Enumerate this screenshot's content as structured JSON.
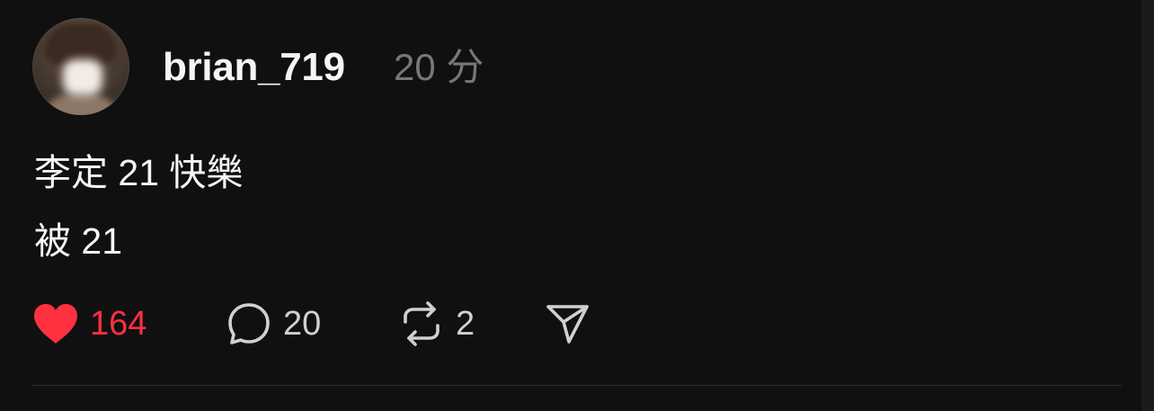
{
  "post": {
    "username": "brian_719",
    "time": "20 分",
    "lines": [
      "李定 21 快樂",
      "被 21"
    ],
    "actions": {
      "like_count": "164",
      "reply_count": "20",
      "repost_count": "2"
    }
  },
  "icons": {
    "like": "heart-filled-icon",
    "reply": "speech-bubble-icon",
    "repost": "repost-arrows-icon",
    "share": "paper-plane-icon"
  },
  "colors": {
    "background": "#101010",
    "like_active": "#ff3040",
    "text_primary": "#f3f5f7",
    "text_secondary": "#777777"
  }
}
